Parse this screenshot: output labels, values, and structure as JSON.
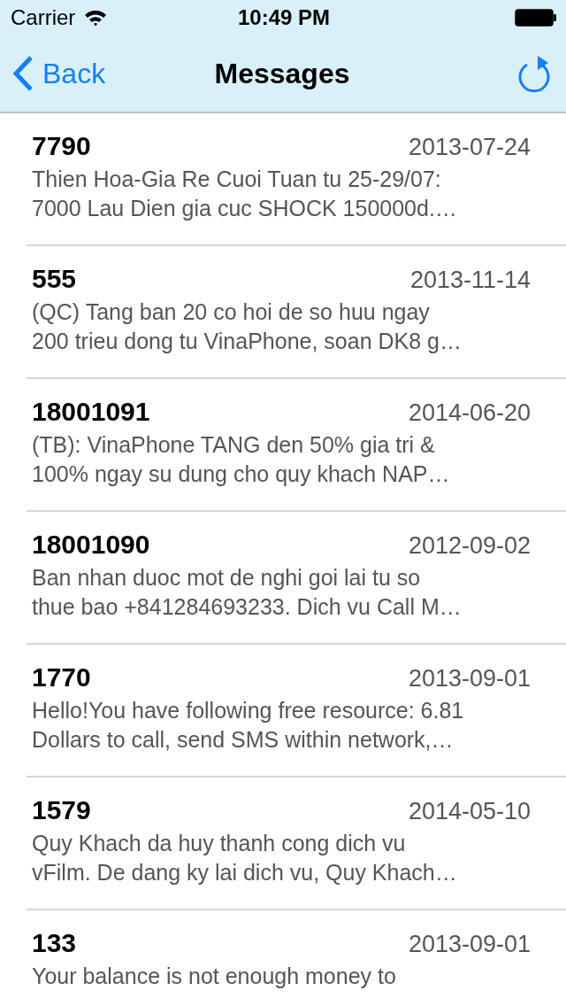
{
  "status_bar": {
    "carrier": "Carrier",
    "time": "10:49 PM"
  },
  "nav_bar": {
    "back": "Back",
    "title": "Messages"
  },
  "messages": [
    {
      "sender": "7790",
      "date": "2013-07-24",
      "preview_lines": [
        "Thien Hoa-Gia Re Cuoi Tuan tu 25-29/07:",
        "7000 Lau Dien gia cuc SHOCK 150000d.…"
      ]
    },
    {
      "sender": "555",
      "date": "2013-11-14",
      "preview_lines": [
        "(QC) Tang ban 20 co hoi de so huu ngay",
        "200 trieu dong tu VinaPhone, soan DK8 g…"
      ]
    },
    {
      "sender": "18001091",
      "date": "2014-06-20",
      "preview_lines": [
        "(TB): VinaPhone TANG den 50% gia tri &",
        "100% ngay su dung cho quy khach NAP…"
      ]
    },
    {
      "sender": "18001090",
      "date": "2012-09-02",
      "preview_lines": [
        "Ban nhan duoc mot de nghi goi lai tu so",
        "thue bao +841284693233. Dich vu Call M…"
      ]
    },
    {
      "sender": "1770",
      "date": "2013-09-01",
      "preview_lines": [
        "Hello!You have following free resource: 6.81",
        "Dollars to call, send SMS within network,…"
      ]
    },
    {
      "sender": "1579",
      "date": "2014-05-10",
      "preview_lines": [
        "Quy Khach da huy thanh cong dich vu",
        "vFilm. De dang ky lai dich vu, Quy Khach…"
      ]
    },
    {
      "sender": "133",
      "date": "2013-09-01",
      "preview_lines": [
        "Your balance is not enough money to"
      ]
    }
  ]
}
